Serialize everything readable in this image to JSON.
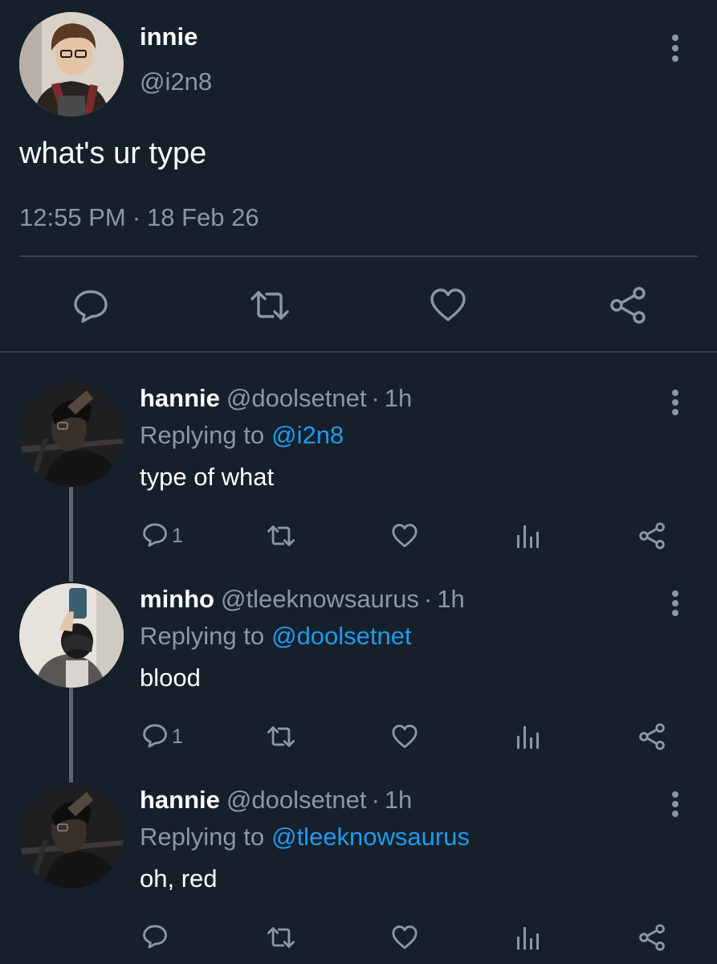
{
  "colors": {
    "background": "#15202b",
    "secondary_text": "#8899a6",
    "link": "#1d9bf0",
    "divider": "#38444d",
    "icon": "#8899a6"
  },
  "tweet": {
    "name": "innie",
    "handle": "@i2n8",
    "text": "what's ur type",
    "time": "12:55 PM",
    "separator": "·",
    "date": "18 Feb 26",
    "actions": [
      "reply-icon",
      "retweet-icon",
      "like-icon",
      "share-icon"
    ]
  },
  "replies": [
    {
      "name": "hannie",
      "handle": "@doolsetnet",
      "separator": "·",
      "time": "1h",
      "replying_label": "Replying to",
      "replying_to": "@i2n8",
      "text": "type of what",
      "reply_count": "1"
    },
    {
      "name": "minho",
      "handle": "@tleeknowsaurus",
      "separator": "·",
      "time": "1h",
      "replying_label": "Replying to",
      "replying_to": "@doolsetnet",
      "text": "blood",
      "reply_count": "1"
    },
    {
      "name": "hannie",
      "handle": "@doolsetnet",
      "separator": "·",
      "time": "1h",
      "replying_label": "Replying to",
      "replying_to": "@tleeknowsaurus",
      "text": "oh, red",
      "reply_count": ""
    }
  ],
  "reply_actions": [
    "reply-icon",
    "retweet-icon",
    "like-icon",
    "analytics-icon",
    "share-icon"
  ]
}
